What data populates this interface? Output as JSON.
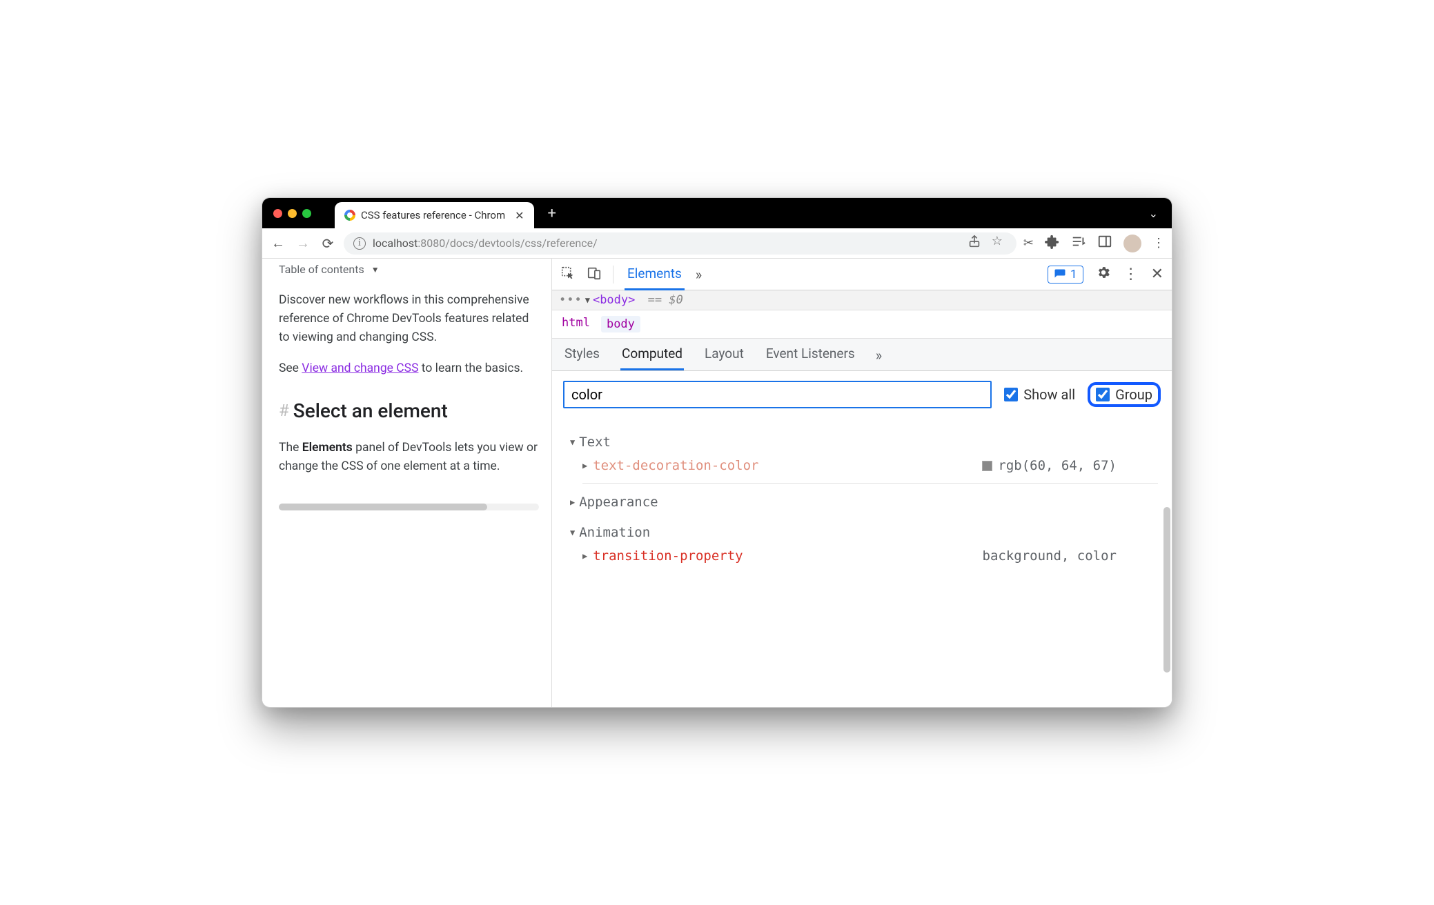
{
  "browser": {
    "tab_title": "CSS features reference - Chrom",
    "new_tab": "+",
    "url_prefix": "localhost",
    "url_port_path": ":8080/docs/devtools/css/reference/",
    "nav": {
      "back": "←",
      "forward": "→",
      "reload": "⟳"
    }
  },
  "page": {
    "toc_label": "Table of contents",
    "intro": "Discover new workflows in this comprehensive reference of Chrome DevTools features related to viewing and changing CSS.",
    "see_prefix": "See ",
    "see_link": "View and change CSS",
    "see_suffix": " to learn the basics.",
    "heading": "Select an element",
    "body_prefix": "The ",
    "body_bold": "Elements",
    "body_suffix": " panel of DevTools lets you view or change the CSS of one element at a time."
  },
  "devtools": {
    "main_tabs": {
      "elements": "Elements"
    },
    "issues_count": "1",
    "dom": {
      "tag": "<body>",
      "eq": "== $0"
    },
    "breadcrumbs": [
      "html",
      "body"
    ],
    "subtabs": {
      "styles": "Styles",
      "computed": "Computed",
      "layout": "Layout",
      "event_listeners": "Event Listeners"
    },
    "filter": {
      "value": "color",
      "show_all": "Show all",
      "group": "Group"
    },
    "groups": {
      "text": {
        "label": "Text",
        "props": [
          {
            "name": "text-decoration-color",
            "value": "rgb(60, 64, 67)",
            "swatch": true,
            "color_class": "sal"
          }
        ]
      },
      "appearance": {
        "label": "Appearance"
      },
      "animation": {
        "label": "Animation",
        "props": [
          {
            "name": "transition-property",
            "value": "background, color",
            "swatch": false,
            "color_class": "red"
          }
        ]
      }
    }
  }
}
